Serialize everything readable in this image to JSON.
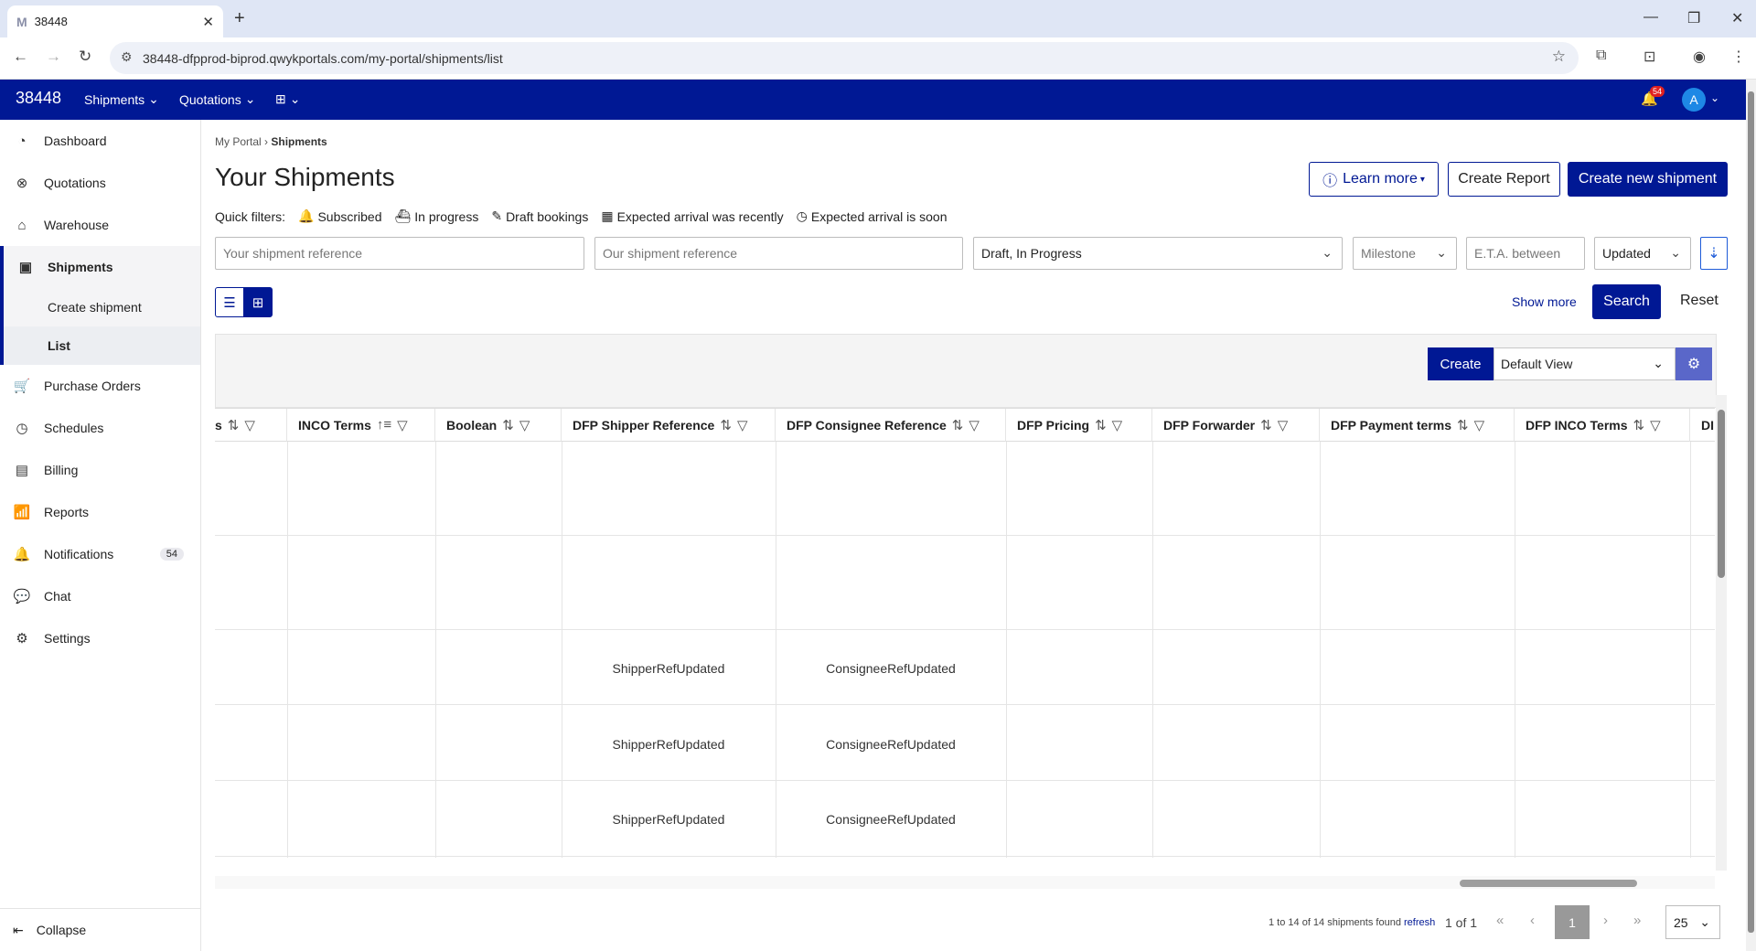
{
  "browser": {
    "tab_title": "38448",
    "tab_favicon": "M",
    "url": "38448-dfpprod-biprod.qwykportals.com/my-portal/shipments/list"
  },
  "topnav": {
    "brand": "38448",
    "items": [
      {
        "label": "Shipments"
      },
      {
        "label": "Quotations"
      }
    ],
    "plus_icon": "plus-square-icon",
    "notif_count": "54",
    "avatar": "A"
  },
  "sidebar": {
    "items": [
      {
        "label": "Dashboard",
        "icon": "◔"
      },
      {
        "label": "Quotations",
        "icon": "⊗"
      },
      {
        "label": "Warehouse",
        "icon": "⌂"
      },
      {
        "label": "Shipments",
        "icon": "▣"
      },
      {
        "label": "Purchase Orders",
        "icon": "🛒"
      },
      {
        "label": "Schedules",
        "icon": "◷"
      },
      {
        "label": "Billing",
        "icon": "▤"
      },
      {
        "label": "Reports",
        "icon": "📶"
      },
      {
        "label": "Notifications",
        "icon": "🔔",
        "badge": "54"
      },
      {
        "label": "Chat",
        "icon": "💬"
      },
      {
        "label": "Settings",
        "icon": "⚙"
      }
    ],
    "sub_items": [
      {
        "label": "Create shipment"
      },
      {
        "label": "List"
      }
    ],
    "collapse": "Collapse"
  },
  "page": {
    "breadcrumb_root": "My Portal",
    "breadcrumb_sep": "›",
    "breadcrumb_current": "Shipments",
    "title": "Your Shipments",
    "learn_more": "Learn more",
    "create_report": "Create Report",
    "create_new": "Create new shipment"
  },
  "quick_filters": {
    "label": "Quick filters:",
    "items": [
      "Subscribed",
      "In progress",
      "Draft bookings",
      "Expected arrival was recently",
      "Expected arrival is soon"
    ]
  },
  "filters": {
    "your_ref_placeholder": "Your shipment reference",
    "our_ref_placeholder": "Our shipment reference",
    "status_value": "Draft, In Progress",
    "milestone_placeholder": "Milestone",
    "eta_placeholder": "E.T.A. between",
    "sort_value": "Updated",
    "show_more": "Show more",
    "search": "Search",
    "reset": "Reset"
  },
  "grid_toolbar": {
    "create": "Create",
    "view": "Default View"
  },
  "table": {
    "columns": [
      {
        "label": "s"
      },
      {
        "label": "INCO Terms"
      },
      {
        "label": "Boolean"
      },
      {
        "label": "DFP Shipper Reference"
      },
      {
        "label": "DFP Consignee Reference"
      },
      {
        "label": "DFP Pricing"
      },
      {
        "label": "DFP Forwarder"
      },
      {
        "label": "DFP Payment terms"
      },
      {
        "label": "DFP INCO Terms"
      },
      {
        "label": "DI"
      }
    ],
    "rows": [
      {
        "shipper": "",
        "consignee": ""
      },
      {
        "shipper": "",
        "consignee": ""
      },
      {
        "shipper": "ShipperRefUpdated",
        "consignee": "ConsigneeRefUpdated"
      },
      {
        "shipper": "ShipperRefUpdated",
        "consignee": "ConsigneeRefUpdated"
      },
      {
        "shipper": "ShipperRefUpdated",
        "consignee": "ConsigneeRefUpdated"
      }
    ]
  },
  "pagination": {
    "info": "1 to 14 of 14 shipments found",
    "refresh": "refresh",
    "page_of": "1 of 1",
    "current": "1",
    "page_size": "25"
  }
}
